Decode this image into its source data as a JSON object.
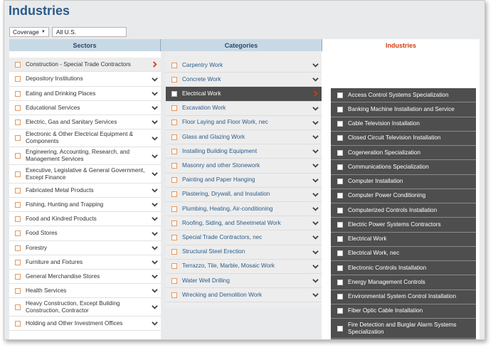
{
  "page": {
    "title": "Industries"
  },
  "filters": {
    "coverage_label": "Coverage",
    "region_value": "All U.S."
  },
  "columns": {
    "sectors": "Sectors",
    "categories": "Categories",
    "industries": "Industries"
  },
  "sectors": [
    {
      "label": "Construction - Special Trade Contractors",
      "selected": true
    },
    {
      "label": "Depository Institutions"
    },
    {
      "label": "Eating and Drinking Places"
    },
    {
      "label": "Educational Services"
    },
    {
      "label": "Electric, Gas and Sanitary Services"
    },
    {
      "label": "Electronic & Other Electrical Equipment & Components"
    },
    {
      "label": "Engineering, Accounting, Research, and Management Services"
    },
    {
      "label": "Executive, Legislative & General Government, Except Finance"
    },
    {
      "label": "Fabricated Metal Products"
    },
    {
      "label": "Fishing, Hunting and Trapping"
    },
    {
      "label": "Food and Kindred Products"
    },
    {
      "label": "Food Stores"
    },
    {
      "label": "Forestry"
    },
    {
      "label": "Furniture and Fixtures"
    },
    {
      "label": "General Merchandise Stores"
    },
    {
      "label": "Health Services"
    },
    {
      "label": "Heavy Construction, Except Building Construction, Contractor"
    },
    {
      "label": "Holding and Other Investment Offices"
    }
  ],
  "categories": [
    {
      "label": "Carpentry Work"
    },
    {
      "label": "Concrete Work"
    },
    {
      "label": "Electrical Work",
      "current": true
    },
    {
      "label": "Excavation Work"
    },
    {
      "label": "Floor Laying and Floor Work, nec"
    },
    {
      "label": "Glass and Glazing Work"
    },
    {
      "label": "Installing Building Equipment"
    },
    {
      "label": "Masonry and other Stonework"
    },
    {
      "label": "Painting and Paper Hanging"
    },
    {
      "label": "Plastering, Drywall, and Insulation"
    },
    {
      "label": "Plumbing, Heating, Air-conditioning"
    },
    {
      "label": "Roofing, Siding, and Sheetmetal Work"
    },
    {
      "label": "Special Trade Contractors, nec"
    },
    {
      "label": "Structural Steel Erection"
    },
    {
      "label": "Terrazzo, Tile, Marble, Mosaic Work"
    },
    {
      "label": "Water Well Drilling"
    },
    {
      "label": "Wrecking and Demolition Work"
    }
  ],
  "industries": [
    {
      "label": "Access Control Systems Specialization"
    },
    {
      "label": "Banking Machine Installation and Service"
    },
    {
      "label": "Cable Television Installation"
    },
    {
      "label": "Closed Circuit Television Installation"
    },
    {
      "label": "Cogeneration Specialization"
    },
    {
      "label": "Communications Specialization"
    },
    {
      "label": "Computer Installation"
    },
    {
      "label": "Computer Power Conditioning"
    },
    {
      "label": "Computerized Controls Installation"
    },
    {
      "label": "Electric Power Systems Contractors"
    },
    {
      "label": "Electrical Work"
    },
    {
      "label": "Electrical Work, nec"
    },
    {
      "label": "Electronic Controls Installation"
    },
    {
      "label": "Energy Management Controls"
    },
    {
      "label": "Environmental System Control Installation"
    },
    {
      "label": "Fiber Optic Cable Installation"
    },
    {
      "label": "Fire Detection and Burglar Alarm Systems Specialization"
    }
  ],
  "colors": {
    "brand_blue": "#2b5b8a",
    "accent_orange": "#d53a0e",
    "header_blue": "#c8d9e6",
    "dark_panel": "#4e4e4e"
  },
  "icons": {
    "expand": "chevron-down-icon",
    "drill": "chevron-right-icon"
  }
}
